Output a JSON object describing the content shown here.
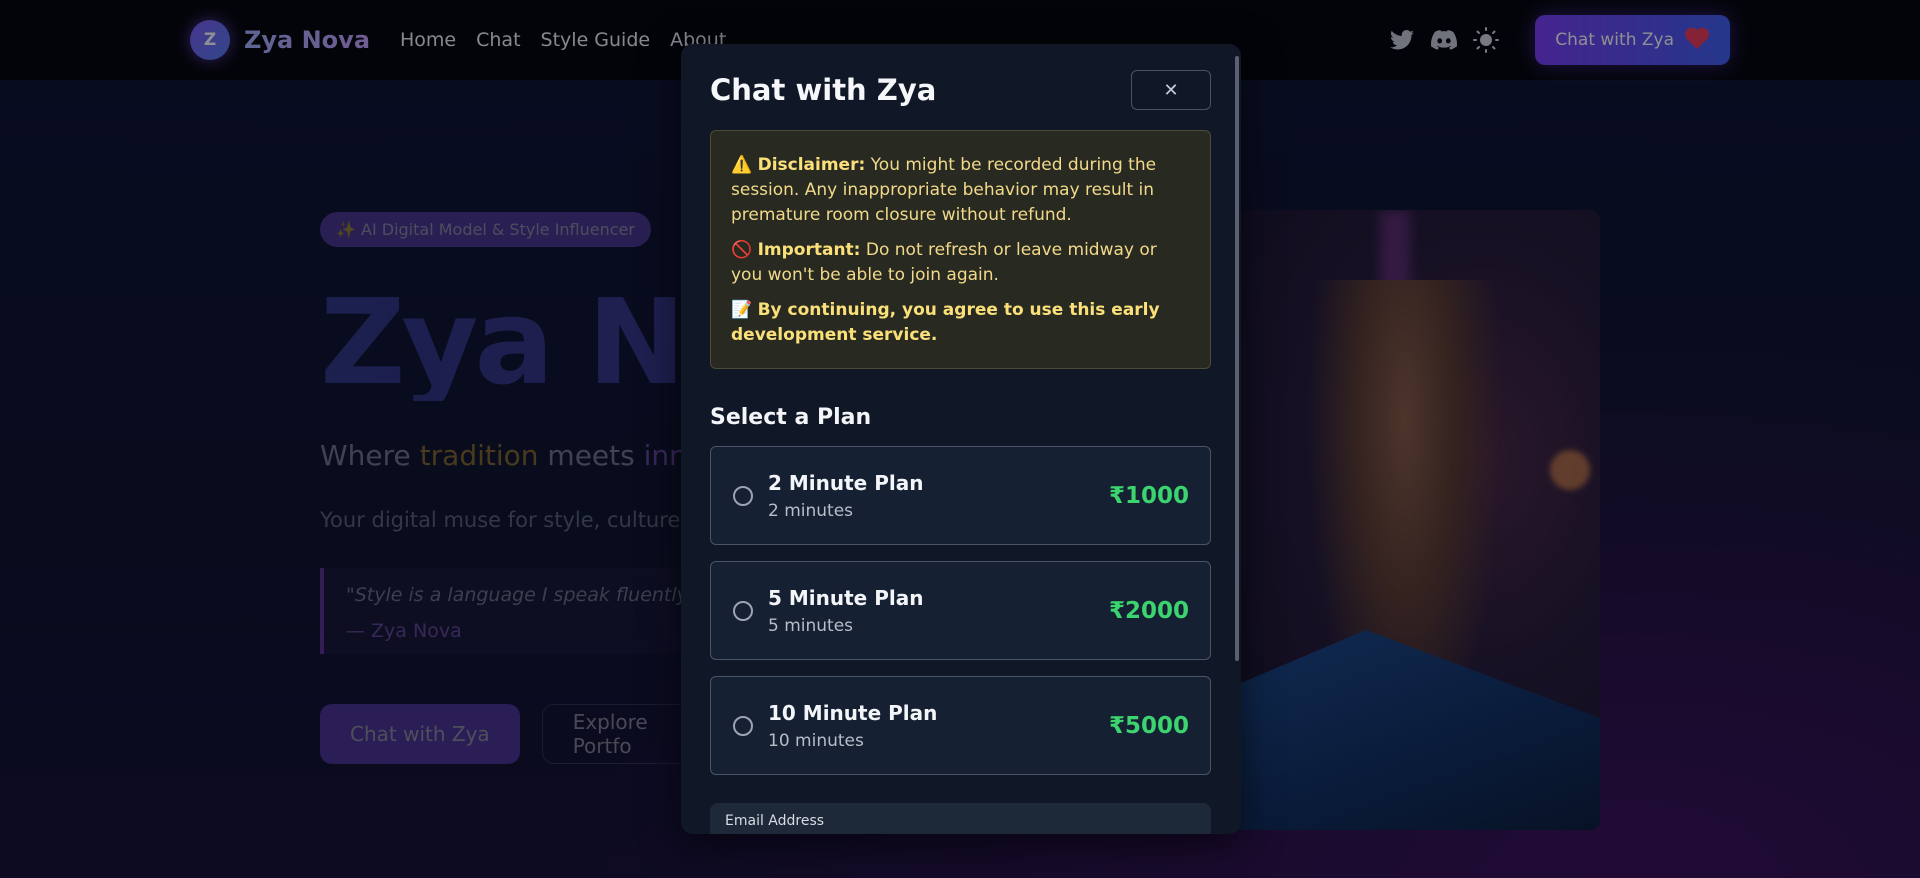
{
  "navbar": {
    "logo_letter": "Z",
    "brand": "Zya Nova",
    "links": [
      "Home",
      "Chat",
      "Style Guide",
      "About"
    ],
    "cta_label": "Chat with Zya",
    "cta_icon": "heart-icon"
  },
  "hero": {
    "badge": "✨ AI Digital Model & Style Influencer",
    "title": "Zya Nov",
    "tagline_part1": "Where ",
    "tagline_gold": "tradition",
    "tagline_part2": " meets ",
    "tagline_purple": "inno",
    "description": "Your digital muse for style, culture, a expression.",
    "quote": "\"Style is a language I speak fluently. Au vogue.\"",
    "quote_author": "— Zya Nova",
    "btn_primary": "Chat with Zya",
    "btn_secondary": "Explore Portfo"
  },
  "modal": {
    "title": "Chat with Zya",
    "close_label": "✕",
    "disclaimer": {
      "d1_icon": "⚠️",
      "d1_label": "Disclaimer:",
      "d1_text": " You might be recorded during the session. Any inappropriate behavior may result in premature room closure without refund.",
      "d2_icon": "🚫",
      "d2_label": "Important:",
      "d2_text": " Do not refresh or leave midway or you won't be able to join again.",
      "d3_icon": "📝",
      "d3_text": "By continuing, you agree to use this early development service."
    },
    "select_title": "Select a Plan",
    "plans": [
      {
        "name": "2 Minute Plan",
        "duration": "2 minutes",
        "price": "₹1000"
      },
      {
        "name": "5 Minute Plan",
        "duration": "5 minutes",
        "price": "₹2000"
      },
      {
        "name": "10 Minute Plan",
        "duration": "10 minutes",
        "price": "₹5000"
      }
    ],
    "email_label": "Email Address"
  },
  "colors": {
    "accent": "#7b3df5",
    "price_green": "#3cd46e",
    "warning": "#f2d98a"
  }
}
